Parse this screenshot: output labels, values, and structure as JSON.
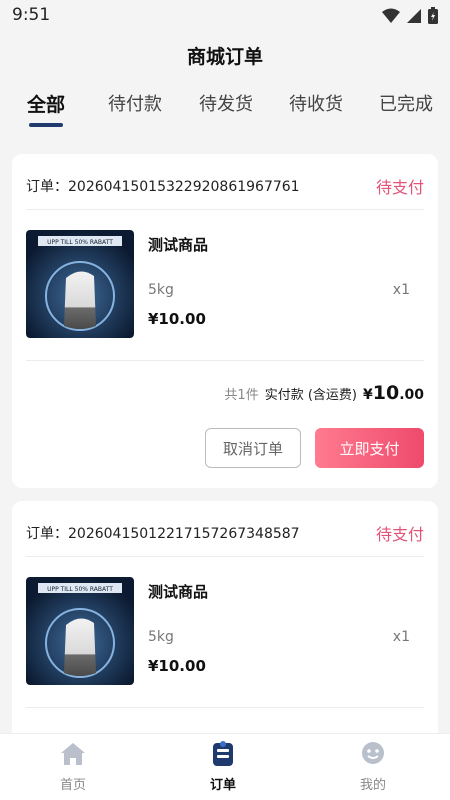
{
  "status_bar": {
    "time": "9:51"
  },
  "header": {
    "title": "商城订单"
  },
  "tabs": [
    {
      "label": "全部",
      "active": true
    },
    {
      "label": "待付款",
      "active": false
    },
    {
      "label": "待发货",
      "active": false
    },
    {
      "label": "待收货",
      "active": false
    },
    {
      "label": "已完成",
      "active": false
    }
  ],
  "orders": [
    {
      "order_label": "订单：",
      "order_number": "2026041501532292086196776​1",
      "status": "待支付",
      "product": {
        "name": "测试商品",
        "spec": "5kg",
        "qty": "x1",
        "price": "¥10.00",
        "image_banner": "UPP TILL 50% RABATT"
      },
      "summary": {
        "count": "共1件",
        "label": "实付款 (含运费)",
        "currency": "¥",
        "amount_int": "10",
        "amount_dec": ".00"
      },
      "buttons": {
        "cancel": "取消订单",
        "pay": "立即支付"
      }
    },
    {
      "order_label": "订单：",
      "order_number": "2026041501221715726734858​7",
      "status": "待支付",
      "product": {
        "name": "测试商品",
        "spec": "5kg",
        "qty": "x1",
        "price": "¥10.00",
        "image_banner": "UPP TILL 50% RABATT"
      }
    }
  ],
  "tabbar": [
    {
      "label": "首页",
      "icon": "home-icon",
      "active": false
    },
    {
      "label": "订单",
      "icon": "order-icon",
      "active": true
    },
    {
      "label": "我的",
      "icon": "profile-icon",
      "active": false
    }
  ],
  "colors": {
    "accent": "#e2527a",
    "tab_underline": "#1f3a6d",
    "pay_button_start": "#ff7b8f",
    "pay_button_end": "#ef4a6c"
  }
}
